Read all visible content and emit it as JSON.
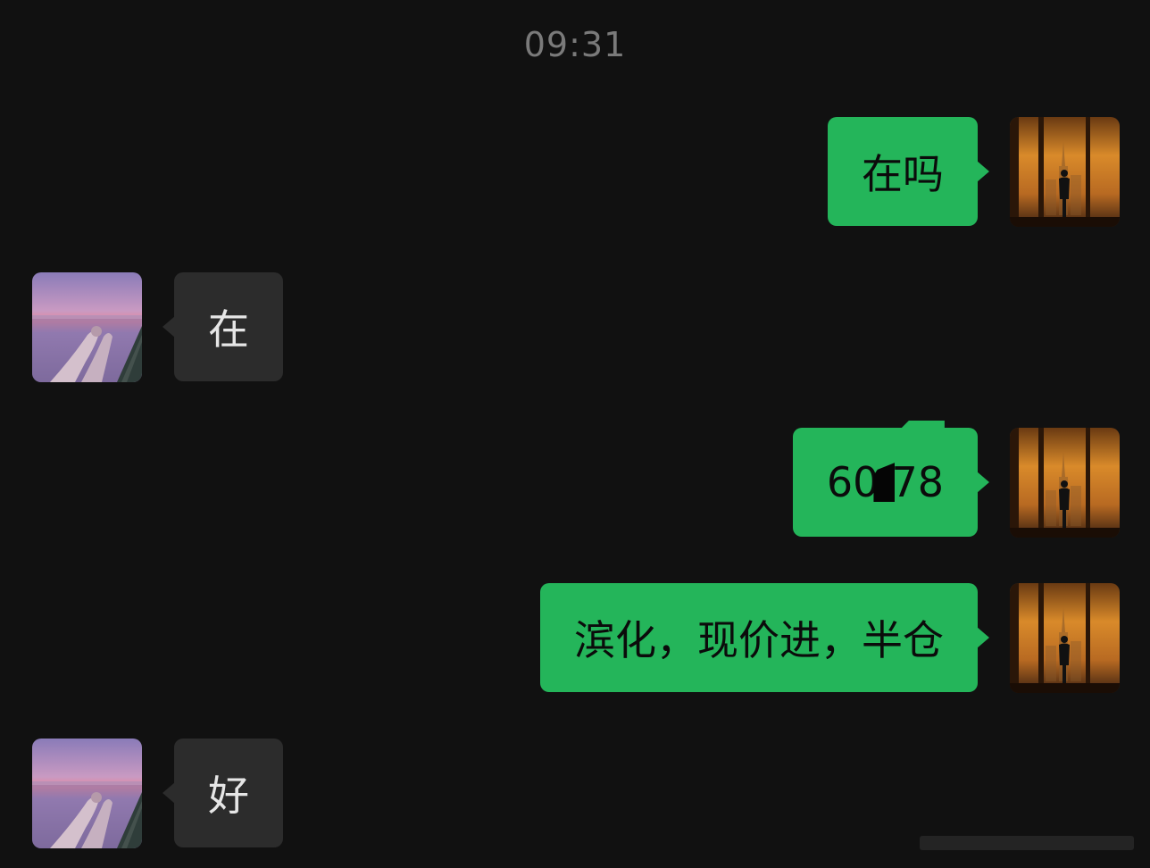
{
  "chat": {
    "timestamp": "09:31",
    "messages": [
      {
        "side": "out",
        "text": "在吗"
      },
      {
        "side": "in",
        "text": "在"
      },
      {
        "side": "out",
        "text_prefix": "60",
        "text_suffix": "78",
        "redacted": true
      },
      {
        "side": "out",
        "text": "滨化，现价进，半仓"
      },
      {
        "side": "in",
        "text": "好"
      }
    ]
  },
  "colors": {
    "background": "#111111",
    "outgoing_bubble": "#24b55a",
    "incoming_bubble": "#2c2c2c",
    "timestamp_text": "#7a7a7a"
  },
  "icons": {
    "self_avatar": "city-window-silhouette-avatar",
    "contact_avatar": "sunset-hands-avatar"
  }
}
